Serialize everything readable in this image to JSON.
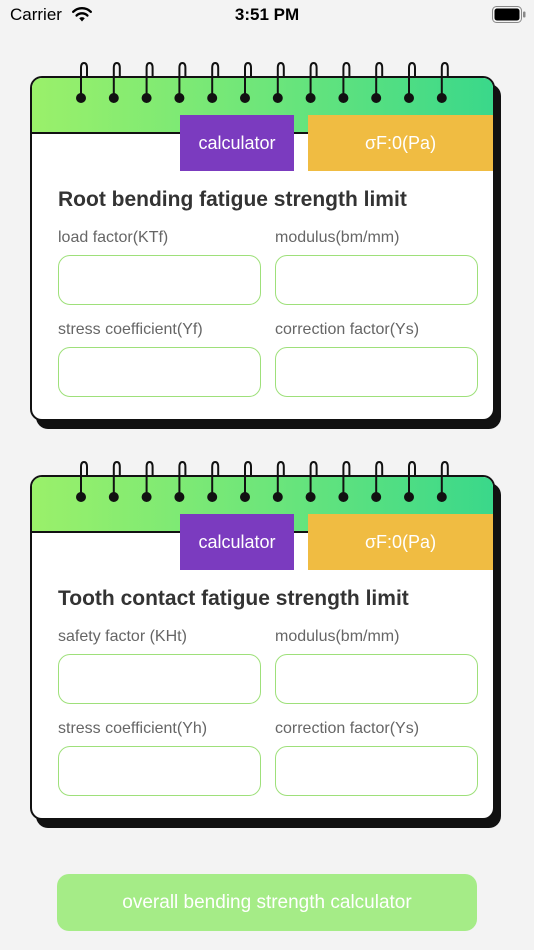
{
  "status_bar": {
    "carrier": "Carrier",
    "time": "3:51 PM",
    "icons": [
      "wifi-icon",
      "battery-icon"
    ]
  },
  "cards": [
    {
      "calculator_label": "calculator",
      "result": "σF:0(Pa)",
      "title": "Root bending fatigue strength limit",
      "fields": [
        {
          "label": "load factor(KTf)",
          "value": "",
          "placeholder": ""
        },
        {
          "label": "modulus(bm/mm)",
          "value": "",
          "placeholder": ""
        },
        {
          "label": "stress coefficient(Yf)",
          "value": "",
          "placeholder": ""
        },
        {
          "label": "correction factor(Ys)",
          "value": "",
          "placeholder": ""
        }
      ]
    },
    {
      "calculator_label": "calculator",
      "result": "σF:0(Pa)",
      "title": "Tooth contact fatigue strength limit",
      "fields": [
        {
          "label": "safety factor (KHt)",
          "value": "",
          "placeholder": ""
        },
        {
          "label": "modulus(bm/mm)",
          "value": "",
          "placeholder": ""
        },
        {
          "label": "stress coefficient(Yh)",
          "value": "",
          "placeholder": ""
        },
        {
          "label": "correction factor(Ys)",
          "value": "",
          "placeholder": ""
        }
      ]
    }
  ],
  "bottom_button": "overall bending strength calculator",
  "colors": {
    "calculator_button": "#7b3bbf",
    "result_box": "#f0bc42",
    "header_gradient_start": "#9af06a",
    "header_gradient_end": "#3ad88a",
    "input_border": "#9ee07a",
    "bottom_button": "#a5ec87"
  }
}
